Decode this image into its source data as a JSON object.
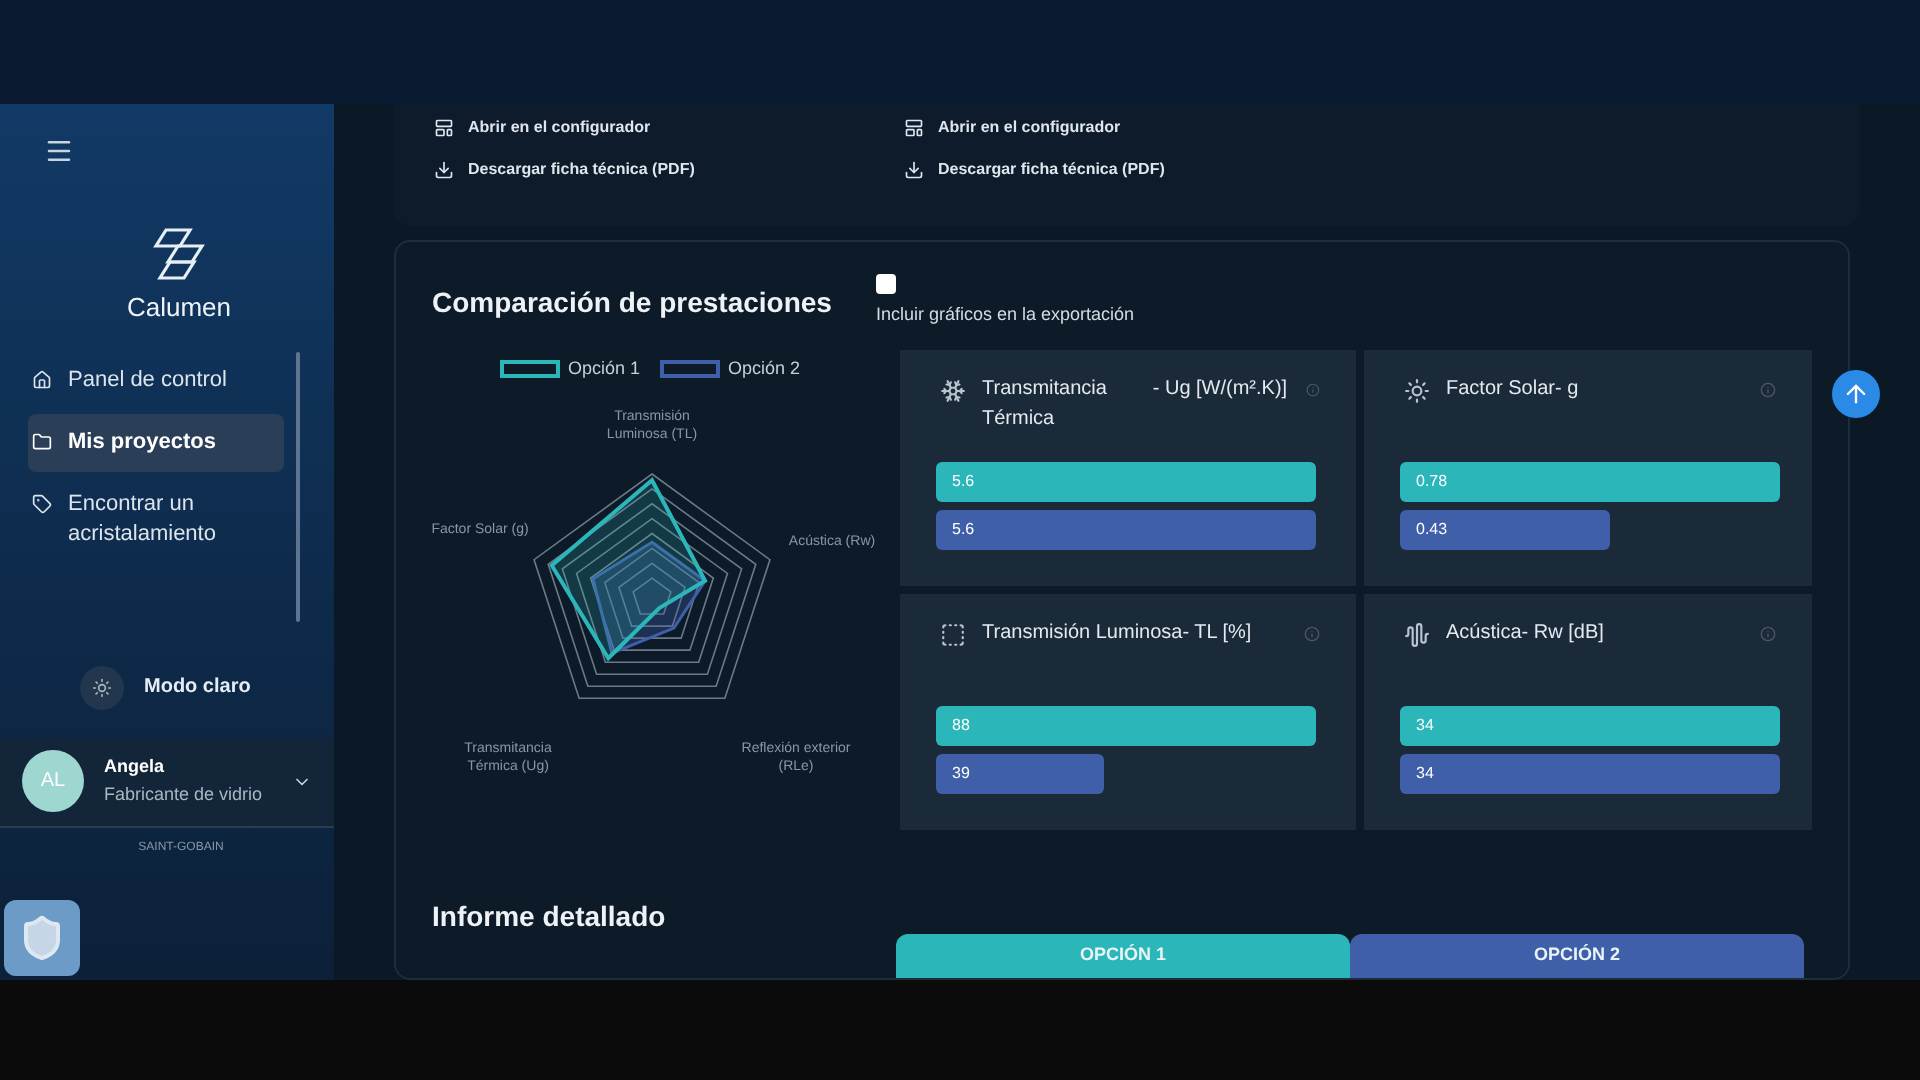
{
  "sidebar": {
    "brand": "Calumen",
    "items": [
      {
        "label": "Panel de control",
        "selected": false
      },
      {
        "label": "Mis proyectos",
        "selected": true
      },
      {
        "label": "Encontrar un acristalamiento",
        "selected": false
      }
    ],
    "theme_toggle": "Modo claro",
    "user": {
      "initials": "AL",
      "name": "Angela",
      "role": "Fabricante de vidrio"
    },
    "footer_logo": "SAINT-GOBAIN"
  },
  "options": [
    {
      "links": [
        "Abrir en el configurador",
        "Descargar ficha técnica (PDF)"
      ]
    },
    {
      "links": [
        "Abrir en el configurador",
        "Descargar ficha técnica (PDF)"
      ]
    }
  ],
  "comparison": {
    "title": "Comparación de prestaciones",
    "include_charts": {
      "label": "Incluir gráficos en la exportación",
      "checked": false
    },
    "legend": [
      {
        "label": "Opción 1",
        "color": "#2bb7b9"
      },
      {
        "label": "Opción 2",
        "color": "#3f5fa8"
      }
    ],
    "radar_axes": [
      "Transmisión Luminosa (TL)",
      "Factor Solar (g)",
      "Acústica (Rw)",
      "Transmitancia Térmica (Ug)",
      "Reflexión exterior (RLe)"
    ],
    "metrics": [
      {
        "title": "Transmitancia Térmica",
        "unit": "- Ug [W/(m².K)]",
        "bars": [
          "5.6",
          "5.6"
        ]
      },
      {
        "title": "Factor Solar- g",
        "bars": [
          "0.78",
          "0.43"
        ]
      },
      {
        "title": "Transmisión Luminosa- TL [%]",
        "bars": [
          "88",
          "39"
        ]
      },
      {
        "title": "Acústica- Rw [dB]",
        "bars": [
          "34",
          "34"
        ]
      }
    ]
  },
  "report": {
    "title": "Informe detallado",
    "tabs": [
      {
        "label": "OPCIÓN 1",
        "color": "#2bb7b9"
      },
      {
        "label": "OPCIÓN 2",
        "color": "#3f5fa8"
      }
    ]
  }
}
